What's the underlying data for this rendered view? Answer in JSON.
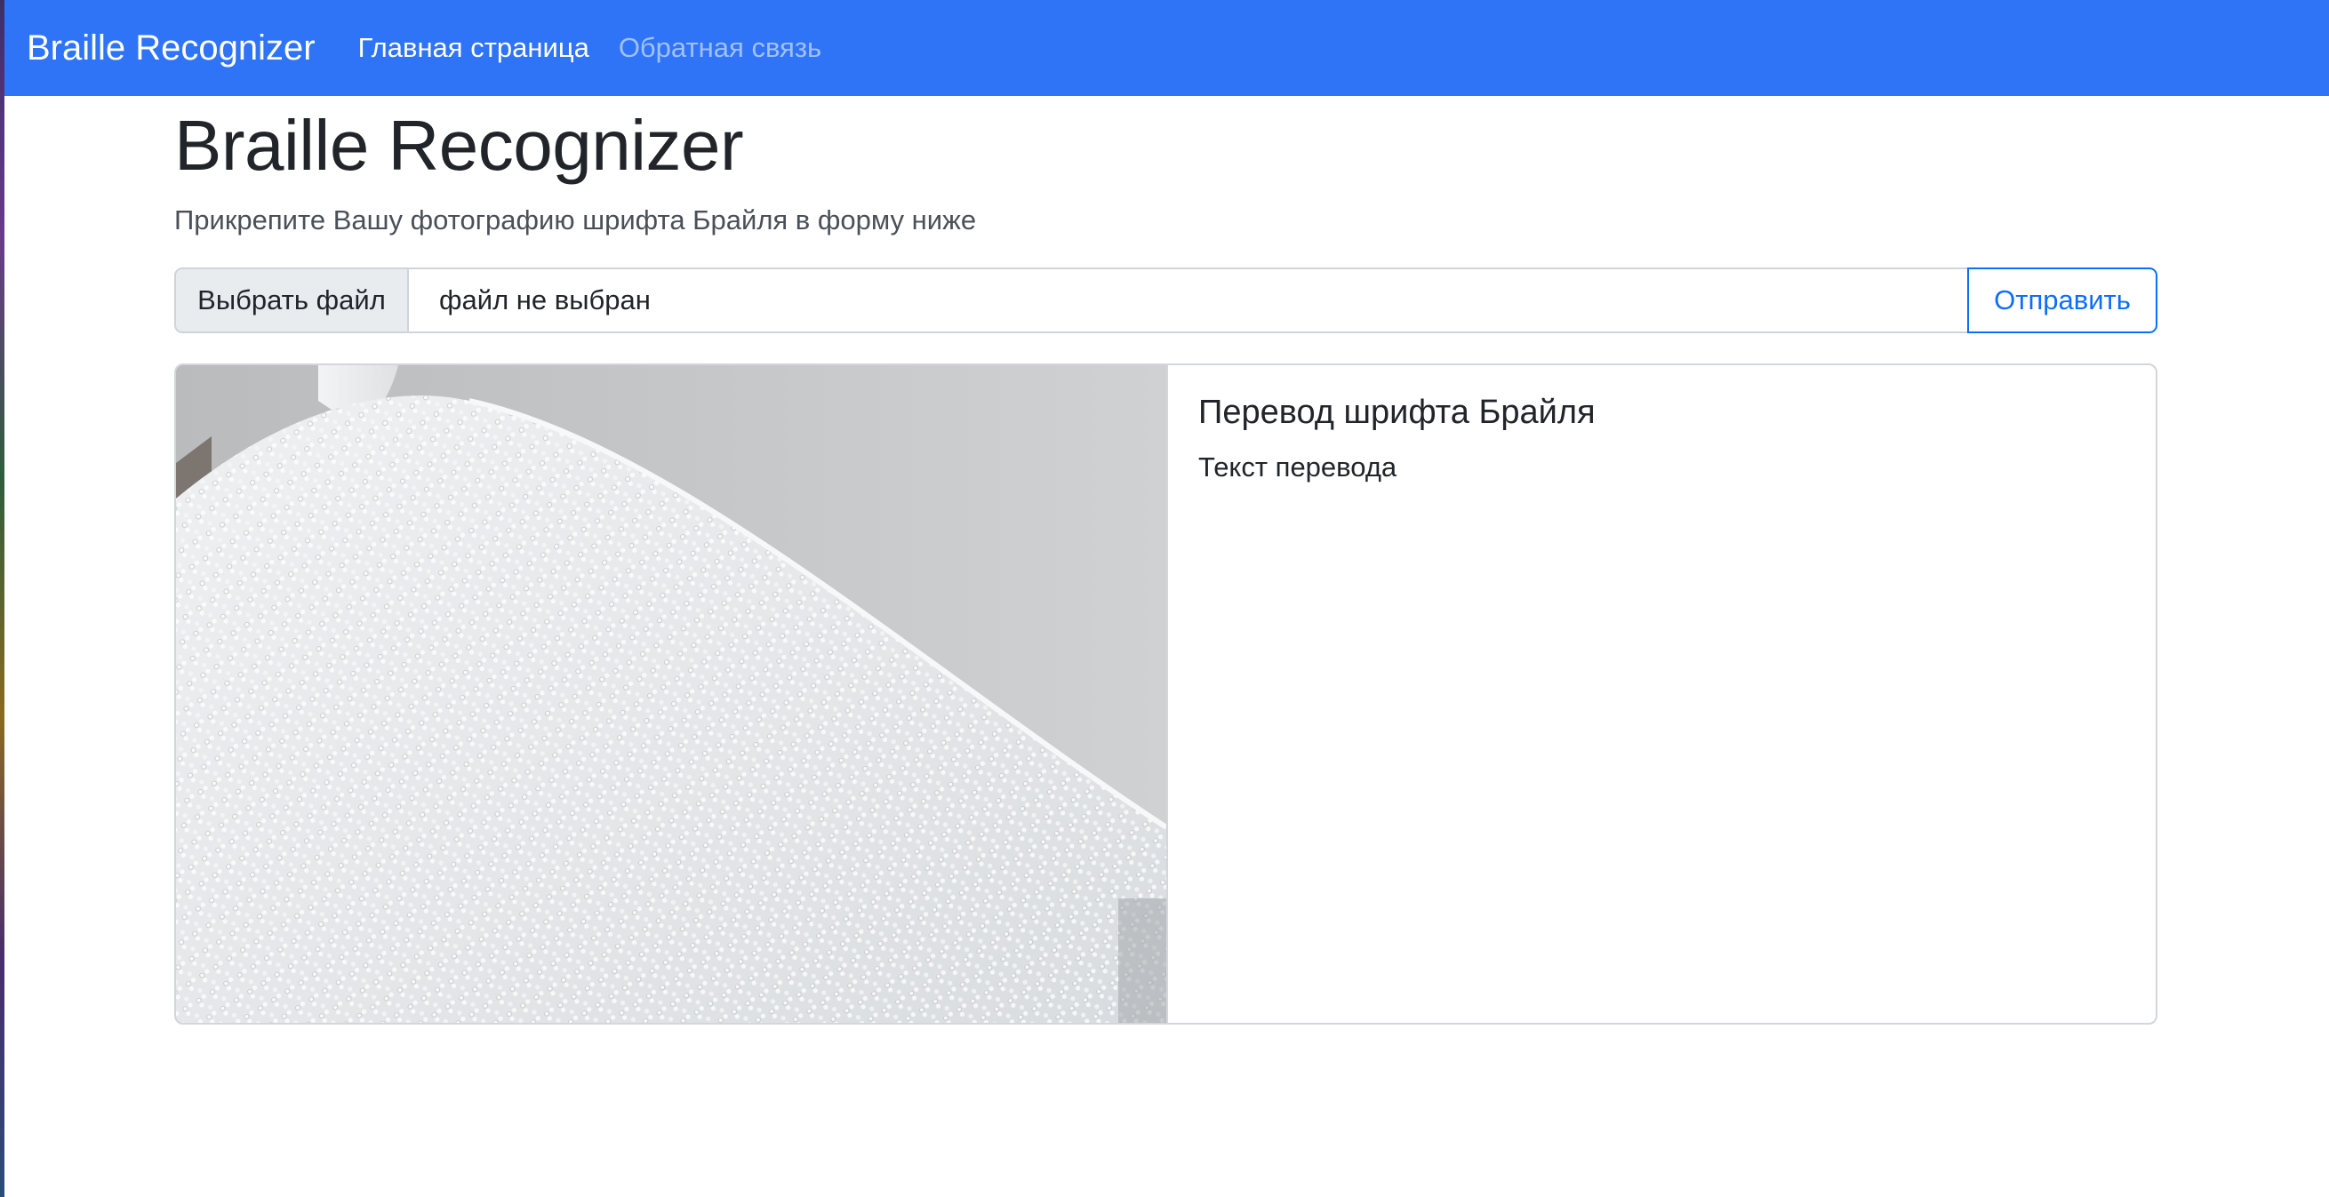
{
  "navbar": {
    "brand": "Braille Recognizer",
    "links": [
      {
        "label": "Главная страница"
      },
      {
        "label": "Обратная связь"
      }
    ],
    "bg_color": "#2f74f6"
  },
  "main": {
    "title": "Braille Recognizer",
    "lead": "Прикрепите Вашу фотографию шрифта Брайля в форму ниже"
  },
  "upload": {
    "choose_label": "Выбрать файл",
    "file_status": "файл не выбран",
    "submit_label": "Отправить"
  },
  "result_card": {
    "image_alt": "braille-page-photo",
    "title": "Перевод шрифта Брайля",
    "text": "Текст перевода"
  },
  "colors": {
    "accent": "#0d6efd"
  }
}
